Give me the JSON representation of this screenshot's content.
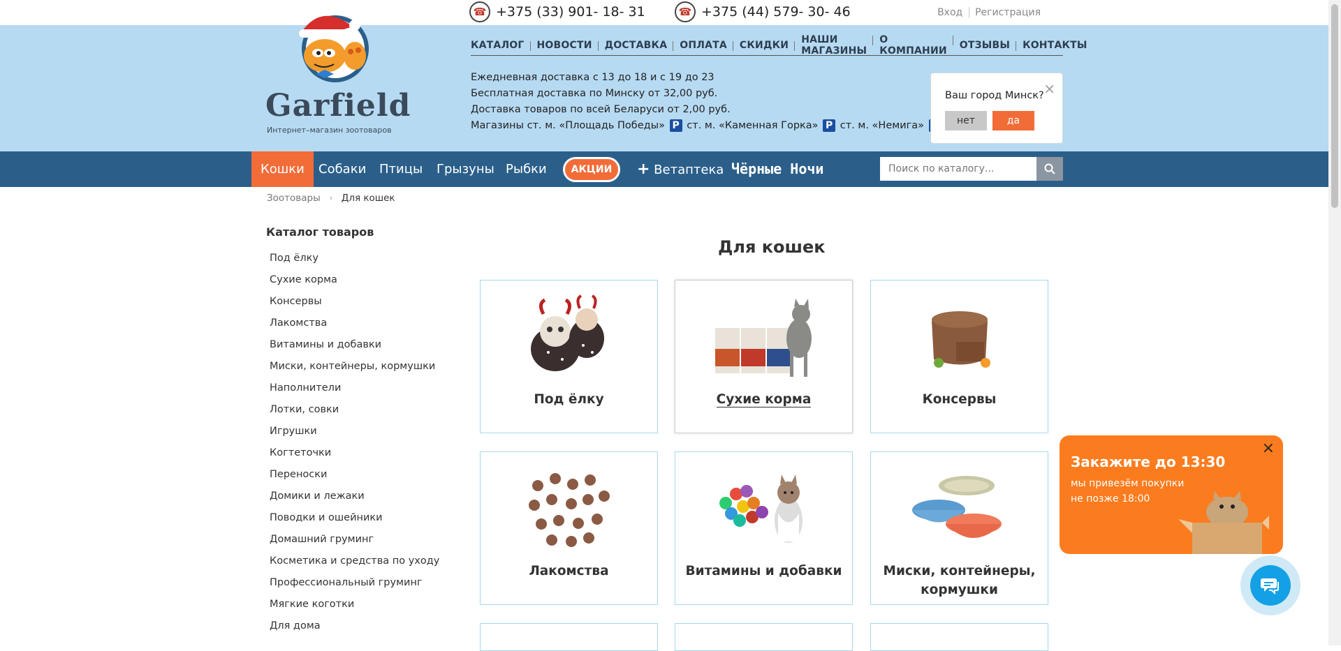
{
  "phones": [
    "+375 (33) 901- 18- 31",
    "+375 (44) 579- 30- 46"
  ],
  "auth": {
    "login": "Вход",
    "register": "Регистрация"
  },
  "logo": {
    "name": "Garfield",
    "tagline": "Интернет–магазин зоотоваров"
  },
  "top_nav": [
    "КАТАЛОГ",
    "НОВОСТИ",
    "ДОСТАВКА",
    "ОПЛАТА",
    "СКИДКИ",
    "НАШИ МАГАЗИНЫ",
    "О КОМПАНИИ",
    "ОТЗЫВЫ",
    "КОНТАКТЫ"
  ],
  "delivery": {
    "line1": "Ежедневная доставка с 13 до 18 и с 19 до 23",
    "line2": "Бесплатная доставка по Минску от 32,00 руб.",
    "line3": "Доставка товаров по всей Беларуси от 2,00 руб.",
    "stores_prefix": "Магазины ст. м. «Площадь Победы»",
    "store2": "ст. м. «Каменная Горка»",
    "store3": "ст. м. «Немига»",
    "parking_badge": "P"
  },
  "city_popup": {
    "question": "Ваш город Минск?",
    "no": "нет",
    "yes": "да",
    "close": "×"
  },
  "main_nav": {
    "items": [
      "Кошки",
      "Собаки",
      "Птицы",
      "Грызуны",
      "Рыбки"
    ],
    "active": "Кошки",
    "promo": "АКЦИИ",
    "vet": "Ветаптека",
    "black_nights": "Чёрные Ночи"
  },
  "search": {
    "placeholder": "Поиск по каталогу..."
  },
  "breadcrumb": {
    "root": "Зоотовары",
    "current": "Для кошек"
  },
  "sidebar": {
    "title": "Каталог товаров",
    "items": [
      "Под ёлку",
      "Сухие корма",
      "Консервы",
      "Лакомства",
      "Витамины и добавки",
      "Миски, контейнеры, кормушки",
      "Наполнители",
      "Лотки, совки",
      "Игрушки",
      "Когтеточки",
      "Переноски",
      "Домики и лежаки",
      "Поводки и ошейники",
      "Домашний груминг",
      "Косметика и средства по уходу",
      "Профессиональный груминг",
      "Мягкие коготки",
      "Для дома"
    ]
  },
  "page_title": "Для кошек",
  "cards": [
    {
      "label": "Под ёлку",
      "icon": "cats-in-costumes-image"
    },
    {
      "label": "Сухие корма",
      "icon": "dry-food-bags-image"
    },
    {
      "label": "Консервы",
      "icon": "canned-food-image"
    },
    {
      "label": "Лакомства",
      "icon": "treats-image"
    },
    {
      "label": "Витамины и добавки",
      "icon": "vitamins-image"
    },
    {
      "label": "Миски, контейнеры, кормушки",
      "icon": "bowls-image"
    }
  ],
  "promo": {
    "title": "Закажите до 13:30",
    "line1": "мы привезём покупки",
    "line2": "не позже 18:00",
    "close": "×"
  },
  "colors": {
    "header_bg": "#b6daf2",
    "nav_bg": "#2b5f8a",
    "accent": "#f26c38",
    "card_border": "#a6d7ee",
    "promo_bg": "#fb7c1e",
    "chat": "#14a0e4"
  }
}
